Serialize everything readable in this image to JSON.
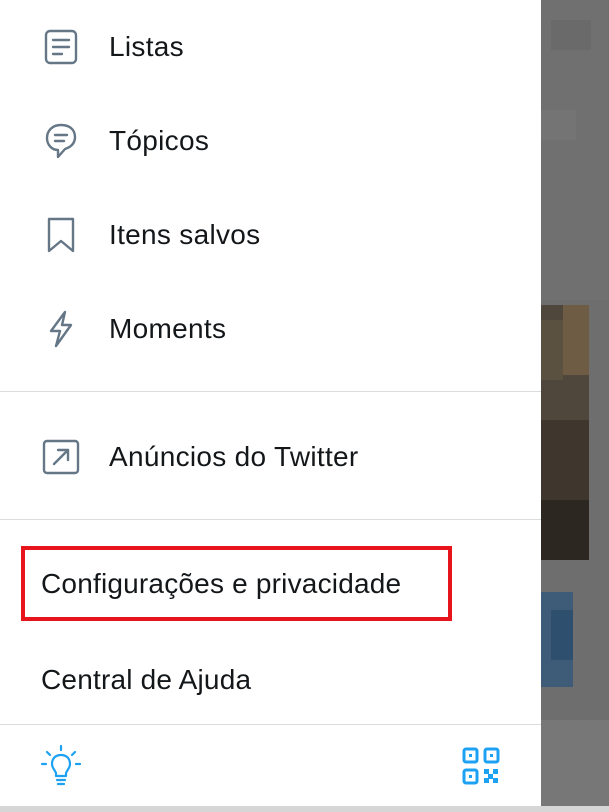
{
  "menu": {
    "items": [
      {
        "label": "Listas",
        "icon": "list-icon"
      },
      {
        "label": "Tópicos",
        "icon": "topics-icon"
      },
      {
        "label": "Itens salvos",
        "icon": "bookmark-icon"
      },
      {
        "label": "Moments",
        "icon": "lightning-icon"
      }
    ],
    "ads": {
      "label": "Anúncios do Twitter",
      "icon": "external-arrow-icon"
    },
    "settings": {
      "label": "Configurações e privacidade"
    },
    "help": {
      "label": "Central de Ajuda"
    }
  },
  "footer": {
    "left_icon": "lightbulb-icon",
    "right_icon": "qr-code-icon"
  },
  "colors": {
    "icon_gray": "#657786",
    "accent_blue": "#1da1f2",
    "highlight_red": "#e8141b",
    "text": "#14171a"
  }
}
